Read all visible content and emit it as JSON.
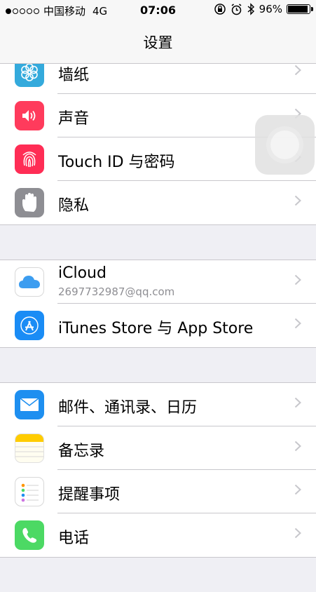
{
  "status_bar": {
    "carrier": "中国移动",
    "network": "4G",
    "time": "07:06",
    "battery_percent": "96%",
    "battery_level": 0.96
  },
  "nav": {
    "title": "设置"
  },
  "groups": [
    [
      {
        "label": "墙纸",
        "icon": "wallpaper-icon"
      },
      {
        "label": "声音",
        "icon": "sound-icon"
      },
      {
        "label": "Touch ID 与密码",
        "icon": "fingerprint-icon"
      },
      {
        "label": "隐私",
        "icon": "privacy-hand-icon"
      }
    ],
    [
      {
        "label": "iCloud",
        "sub": "2697732987@qq.com",
        "icon": "icloud-icon"
      },
      {
        "label": "iTunes Store 与 App Store",
        "icon": "app-store-icon"
      }
    ],
    [
      {
        "label": "邮件、通讯录、日历",
        "icon": "mail-icon"
      },
      {
        "label": "备忘录",
        "icon": "notes-icon"
      },
      {
        "label": "提醒事项",
        "icon": "reminders-icon"
      },
      {
        "label": "电话",
        "icon": "phone-icon"
      }
    ]
  ],
  "colors": {
    "sound": "#ff3b5c",
    "fingerprint": "#ff2d55",
    "privacy": "#8e8e93",
    "appstore": "#1a8cf5",
    "mail": "#1e8ff0",
    "phone": "#4cd964",
    "notes": "#ffcc00",
    "wallpaper": "#34aadc"
  }
}
